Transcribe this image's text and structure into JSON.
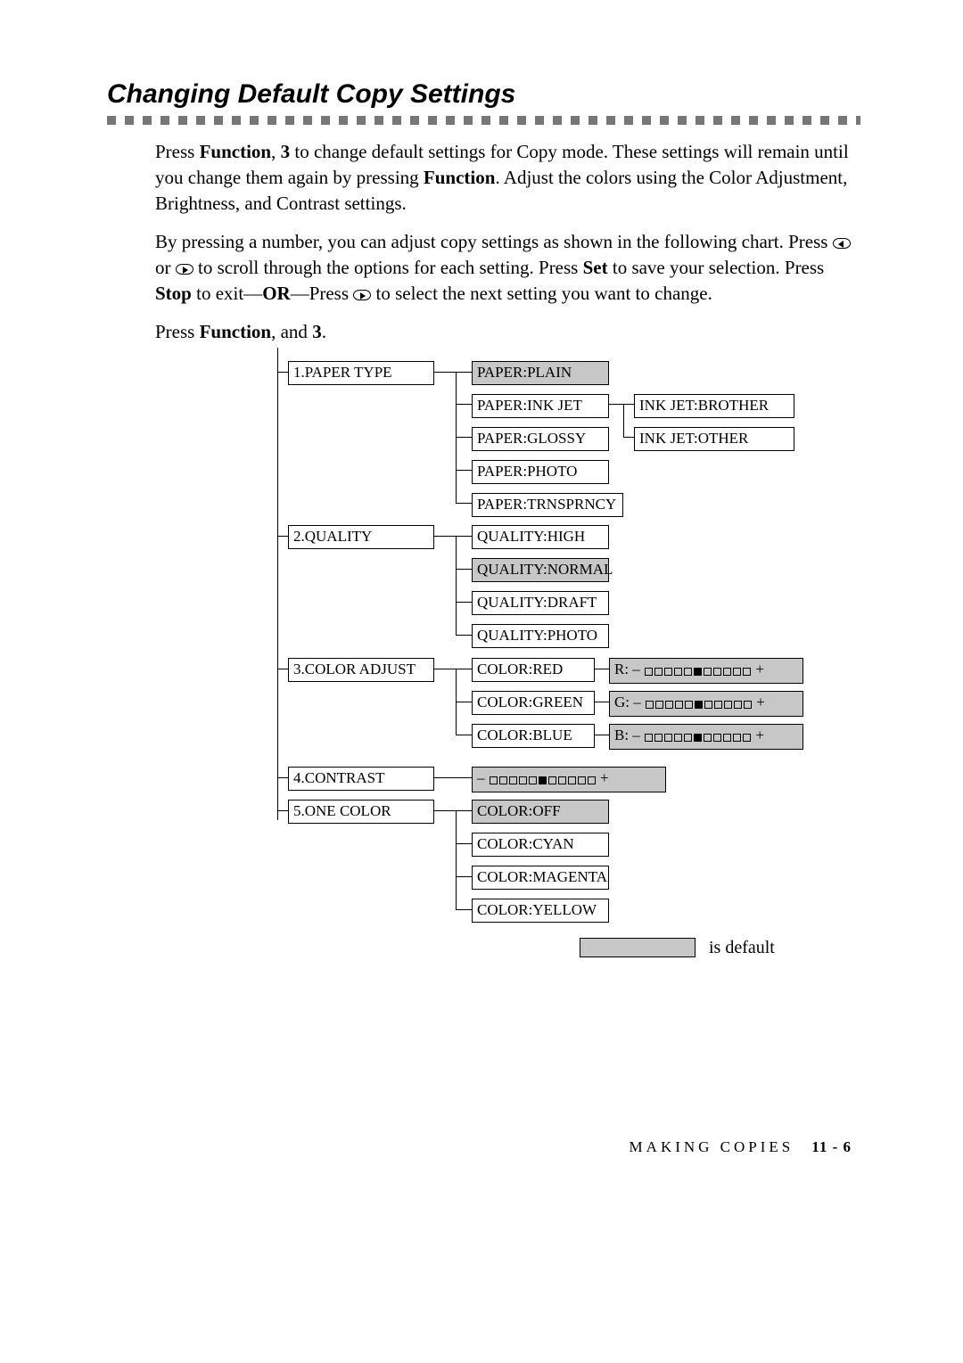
{
  "title": "Changing Default Copy Settings",
  "para1_parts": [
    "Press ",
    "Function",
    ", ",
    "3",
    " to change default settings for Copy mode. These settings will remain until you change them again by pressing ",
    "Function",
    ". Adjust the colors using the Color Adjustment, Brightness, and Contrast settings."
  ],
  "para2_parts": [
    "By pressing a number, you can adjust copy settings as shown in the following chart. Press ",
    "",
    " or ",
    "",
    " to scroll through the options for each setting. Press ",
    "Set",
    " to save your selection. Press ",
    "Stop",
    " to exit—",
    "OR",
    "—Press ",
    "",
    " to select the next setting you want to change."
  ],
  "press_line_parts": [
    "Press ",
    "Function",
    ", and ",
    "3",
    "."
  ],
  "menu": {
    "lvl1": [
      "1.PAPER TYPE",
      "2.QUALITY",
      "3.COLOR ADJUST",
      "4.CONTRAST",
      "5.ONE COLOR"
    ],
    "paper": [
      "PAPER:PLAIN",
      "PAPER:INK JET",
      "PAPER:GLOSSY",
      "PAPER:PHOTO",
      "PAPER:TRNSPRNCY"
    ],
    "inkjet": [
      "INK JET:BROTHER",
      "INK JET:OTHER"
    ],
    "quality": [
      "QUALITY:HIGH",
      "QUALITY:NORMAL",
      "QUALITY:DRAFT",
      "QUALITY:PHOTO"
    ],
    "color": [
      "COLOR:RED",
      "COLOR:GREEN",
      "COLOR:BLUE"
    ],
    "color_bars": [
      "R: –",
      "G: –",
      "B: –"
    ],
    "one_color": [
      "COLOR:OFF",
      "COLOR:CYAN",
      "COLOR:MAGENTA",
      "COLOR:YELLOW"
    ]
  },
  "legend_text": " is default",
  "footer_section": "MAKING COPIES",
  "footer_page": "11 - 6"
}
